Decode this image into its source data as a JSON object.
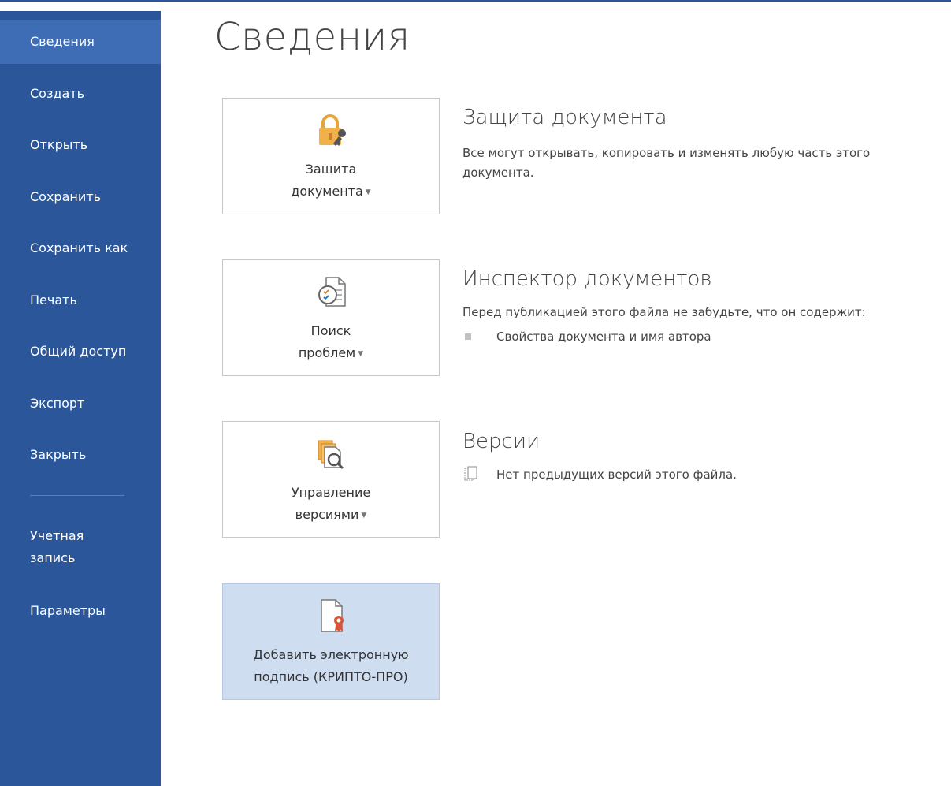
{
  "sidebar": {
    "items": [
      {
        "label": "Сведения"
      },
      {
        "label": "Создать"
      },
      {
        "label": "Открыть"
      },
      {
        "label": "Сохранить"
      },
      {
        "label": "Сохранить как"
      },
      {
        "label": "Печать"
      },
      {
        "label": "Общий доступ"
      },
      {
        "label": "Экспорт"
      },
      {
        "label": "Закрыть"
      }
    ],
    "account": {
      "line1": "Учетная",
      "line2": "запись"
    },
    "options": {
      "label": "Параметры"
    }
  },
  "page": {
    "title": "Сведения"
  },
  "tiles": {
    "protect": {
      "line1": "Защита",
      "line2": "документа",
      "icon": "lock-key-icon"
    },
    "inspect": {
      "line1": "Поиск",
      "line2": "проблем",
      "icon": "inspect-document-icon"
    },
    "versions": {
      "line1": "Управление",
      "line2": "версиями",
      "icon": "manage-versions-icon"
    },
    "signature": {
      "line1": "Добавить электронную",
      "line2": "подпись (КРИПТО-ПРО)",
      "icon": "signature-certificate-icon"
    }
  },
  "sections": {
    "protect": {
      "title": "Защита документа",
      "desc_line1": "Все могут открывать, копировать и изменять любую часть этого",
      "desc_line2": "документа."
    },
    "inspect": {
      "title": "Инспектор документов",
      "desc": "Перед публикацией этого файла не забудьте, что он содержит:",
      "bullets": [
        "Свойства документа и имя автора"
      ]
    },
    "versions": {
      "title": "Версии",
      "desc": "Нет предыдущих версий этого файла."
    }
  },
  "colors": {
    "sidebar": "#2b579a",
    "sidebar_active": "#3e6db5",
    "tile_highlight": "#cfddf1",
    "lock_gold": "#e8a33d"
  }
}
